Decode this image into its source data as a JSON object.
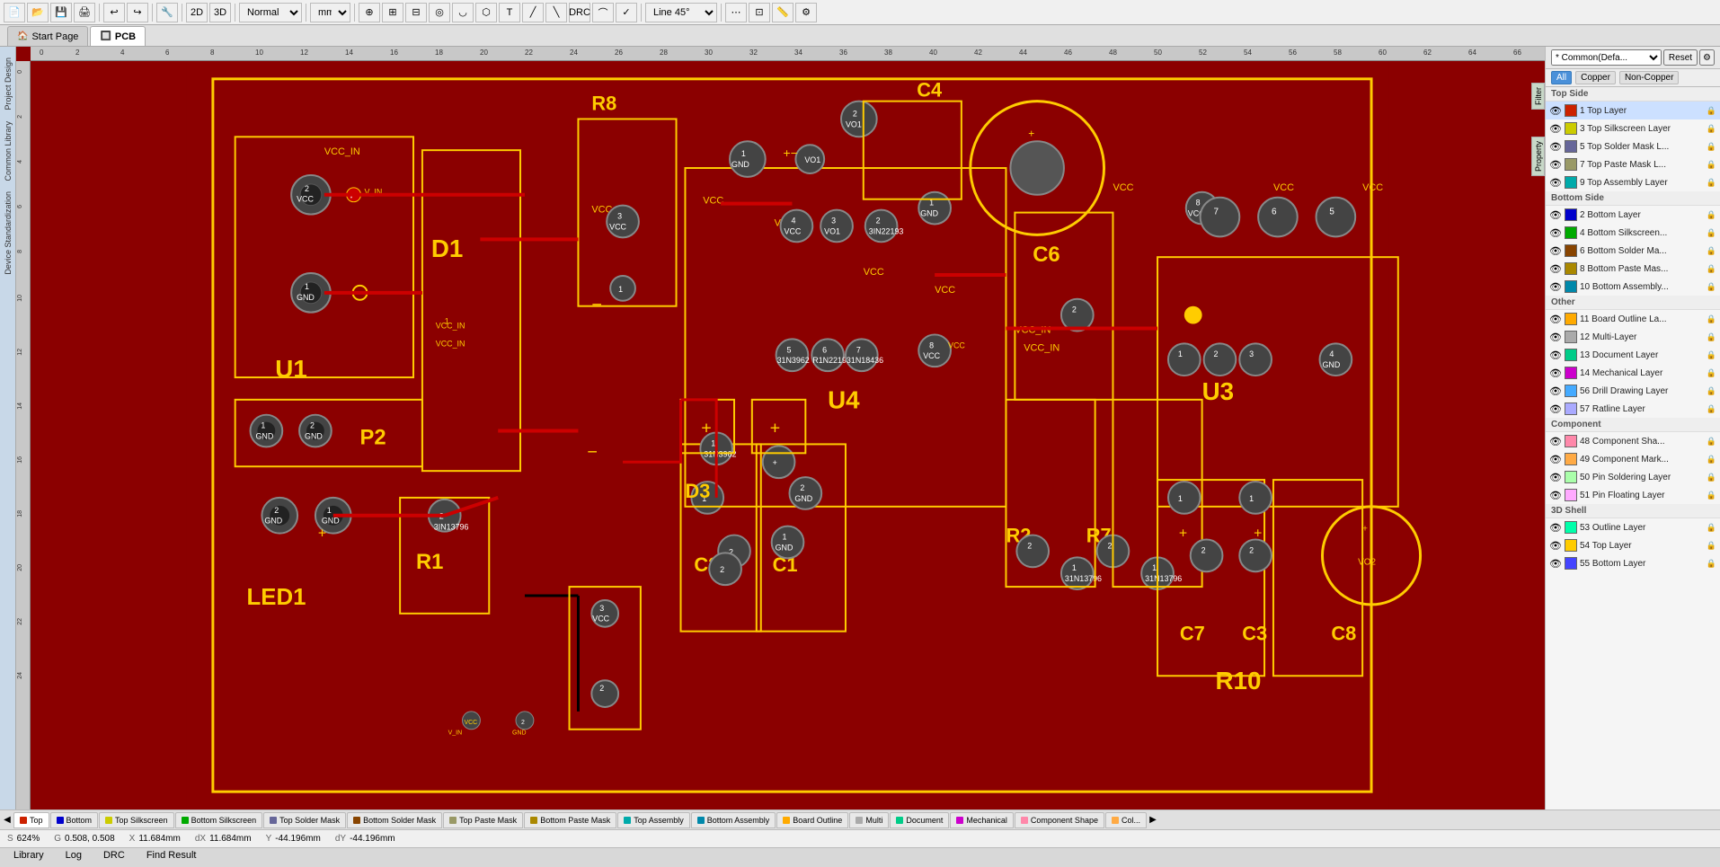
{
  "toolbar": {
    "mode_label": "Normal",
    "unit_label": "mm",
    "line_angle_label": "Line 45°",
    "buttons": [
      "new",
      "open",
      "save",
      "print",
      "undo",
      "redo",
      "interactive_router",
      "2d",
      "3d",
      "design_rule",
      "measure",
      "place_component",
      "place_wire",
      "place_via",
      "place_arc",
      "place_polygon",
      "place_text",
      "place_dimension",
      "drc",
      "teardrops"
    ]
  },
  "tabs": [
    {
      "label": "Start Page",
      "icon": "🏠",
      "active": false
    },
    {
      "label": "PCB",
      "icon": "🔲",
      "active": true
    }
  ],
  "left_panel_tabs": [
    "Project Design",
    "Common Library",
    "Device Standardization"
  ],
  "layer_panel": {
    "preset_label": "* Common(Defa...",
    "reset_label": "Reset",
    "filter_buttons": [
      {
        "label": "All",
        "active": true
      },
      {
        "label": "Copper",
        "active": false
      },
      {
        "label": "Non-Copper",
        "active": false
      }
    ],
    "groups": [
      {
        "name": "Top Side",
        "items": [
          {
            "name": "1 Top Layer",
            "color": "#cc2200",
            "visible": true,
            "selected": true,
            "lock": true
          },
          {
            "name": "3 Top Silkscreen Layer",
            "color": "#cccc00",
            "visible": true,
            "selected": false,
            "lock": true
          },
          {
            "name": "5 Top Solder Mask L...",
            "color": "#666699",
            "visible": true,
            "selected": false,
            "lock": true
          },
          {
            "name": "7 Top Paste Mask L...",
            "color": "#999966",
            "visible": true,
            "selected": false,
            "lock": true
          },
          {
            "name": "9 Top Assembly Layer",
            "color": "#00aaaa",
            "visible": true,
            "selected": false,
            "lock": true
          }
        ]
      },
      {
        "name": "Bottom Side",
        "items": [
          {
            "name": "2 Bottom Layer",
            "color": "#0000cc",
            "visible": true,
            "selected": false,
            "lock": true
          },
          {
            "name": "4 Bottom Silkscreen...",
            "color": "#00aa00",
            "visible": true,
            "selected": false,
            "lock": true
          },
          {
            "name": "6 Bottom Solder Ma...",
            "color": "#884400",
            "visible": true,
            "selected": false,
            "lock": true
          },
          {
            "name": "8 Bottom Paste Mas...",
            "color": "#aa8800",
            "visible": true,
            "selected": false,
            "lock": true
          },
          {
            "name": "10 Bottom Assembly...",
            "color": "#0088aa",
            "visible": true,
            "selected": false,
            "lock": true
          }
        ]
      },
      {
        "name": "Other",
        "items": [
          {
            "name": "11 Board Outline La...",
            "color": "#ffaa00",
            "visible": true,
            "selected": false,
            "lock": true
          },
          {
            "name": "12 Multi-Layer",
            "color": "#aaaaaa",
            "visible": true,
            "selected": false,
            "lock": true
          },
          {
            "name": "13 Document Layer",
            "color": "#00cc88",
            "visible": true,
            "selected": false,
            "lock": true
          },
          {
            "name": "14 Mechanical Layer",
            "color": "#cc00cc",
            "visible": true,
            "selected": false,
            "lock": true
          },
          {
            "name": "56 Drill Drawing Layer",
            "color": "#44aaff",
            "visible": true,
            "selected": false,
            "lock": true
          },
          {
            "name": "57 Ratline Layer",
            "color": "#aaaaff",
            "visible": true,
            "selected": false,
            "lock": true
          }
        ]
      },
      {
        "name": "Component",
        "items": [
          {
            "name": "48 Component Sha...",
            "color": "#ff88aa",
            "visible": true,
            "selected": false,
            "lock": true
          },
          {
            "name": "49 Component Mark...",
            "color": "#ffaa44",
            "visible": true,
            "selected": false,
            "lock": true
          },
          {
            "name": "50 Pin Soldering Layer",
            "color": "#aaffaa",
            "visible": true,
            "selected": false,
            "lock": true
          },
          {
            "name": "51 Pin Floating Layer",
            "color": "#ffaaff",
            "visible": true,
            "selected": false,
            "lock": true
          }
        ]
      },
      {
        "name": "3D Shell",
        "items": [
          {
            "name": "53 Outline Layer",
            "color": "#00ffaa",
            "visible": true,
            "selected": false,
            "lock": true
          },
          {
            "name": "54 Top Layer",
            "color": "#ffcc00",
            "visible": true,
            "selected": false,
            "lock": true
          },
          {
            "name": "55 Bottom Layer",
            "color": "#4444ff",
            "visible": true,
            "selected": false,
            "lock": true
          }
        ]
      }
    ]
  },
  "status_bar": {
    "scale_label": "S",
    "scale_value": "624%",
    "g_label": "G",
    "g_value": "0.508, 0.508",
    "x_label": "X",
    "x_value": "11.684mm",
    "dx_label": "dX",
    "dx_value": "11.684mm",
    "y_label": "Y",
    "y_value": "-44.196mm",
    "dy_label": "dY",
    "dy_value": "-44.196mm"
  },
  "bottom_layer_tabs": [
    {
      "label": "Top",
      "color": "#cc2200",
      "active": true
    },
    {
      "label": "Bottom",
      "color": "#0000cc",
      "active": false
    },
    {
      "label": "Top Silkscreen",
      "color": "#cccc00",
      "active": false
    },
    {
      "label": "Bottom Silkscreen",
      "color": "#00aa00",
      "active": false
    },
    {
      "label": "Top Solder Mask",
      "color": "#666699",
      "active": false
    },
    {
      "label": "Bottom Solder Mask",
      "color": "#884400",
      "active": false
    },
    {
      "label": "Top Paste Mask",
      "color": "#999966",
      "active": false
    },
    {
      "label": "Bottom Paste Mask",
      "color": "#aa8800",
      "active": false
    },
    {
      "label": "Top Assembly",
      "color": "#00aaaa",
      "active": false
    },
    {
      "label": "Bottom Assembly",
      "color": "#0088aa",
      "active": false
    },
    {
      "label": "Board Outline",
      "color": "#ffaa00",
      "active": false
    },
    {
      "label": "Multi",
      "color": "#aaaaaa",
      "active": false
    },
    {
      "label": "Document",
      "color": "#00cc88",
      "active": false
    },
    {
      "label": "Mechanical",
      "color": "#cc00cc",
      "active": false
    },
    {
      "label": "Component Shape",
      "color": "#ff88aa",
      "active": false
    },
    {
      "label": "Col...",
      "color": "#ffaa44",
      "active": false
    }
  ],
  "footer_tabs": [
    {
      "label": "Library",
      "active": false
    },
    {
      "label": "Log",
      "active": false
    },
    {
      "label": "DRC",
      "active": false
    },
    {
      "label": "Find Result",
      "active": false
    }
  ],
  "right_side_tabs": [
    "Filter",
    "Property"
  ]
}
